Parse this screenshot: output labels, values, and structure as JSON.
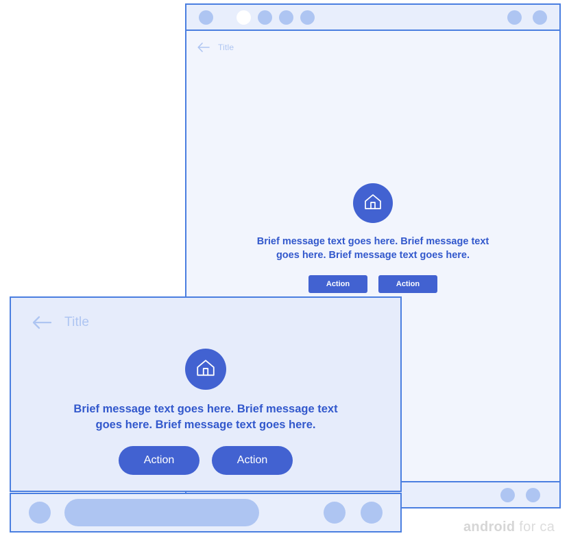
{
  "meta": {
    "watermark_bold": "android",
    "watermark_rest": " for ca"
  },
  "rear_window": {
    "status_bar": {
      "left_dots": [
        {
          "name": "status-dot-1",
          "filled": false
        },
        {
          "name": "status-dot-2",
          "filled": true
        },
        {
          "name": "status-dot-3",
          "filled": false
        },
        {
          "name": "status-dot-4",
          "filled": false
        },
        {
          "name": "status-dot-5",
          "filled": false
        }
      ],
      "right_dots": [
        {
          "name": "status-dot-right-1"
        },
        {
          "name": "status-dot-right-2"
        }
      ]
    },
    "app_bar": {
      "back_icon": "back-arrow-icon",
      "title": "Title"
    },
    "content": {
      "icon": "home-icon",
      "message": "Brief message text goes here. Brief message text goes here. Brief message text goes here.",
      "buttons": [
        {
          "label": "Action"
        },
        {
          "label": "Action"
        }
      ]
    },
    "bottom_bar": {
      "dots": [
        {
          "name": "bottom-dot-1"
        },
        {
          "name": "bottom-dot-2"
        }
      ]
    }
  },
  "front_window": {
    "app_bar": {
      "back_icon": "back-arrow-icon",
      "title": "Title"
    },
    "content": {
      "icon": "home-icon",
      "message": "Brief message text goes here. Brief message text goes here. Brief message text goes here.",
      "buttons": [
        {
          "label": "Action"
        },
        {
          "label": "Action"
        }
      ]
    },
    "nav_bar": {
      "home_dot": "nav-home-button",
      "search_pill": "nav-search-field",
      "right_dots": [
        {
          "name": "nav-dot-1"
        },
        {
          "name": "nav-dot-2"
        }
      ]
    }
  },
  "colors": {
    "accent": "#4262d1",
    "text_blue": "#3258cc",
    "muted_blue": "#aec5f2",
    "border_blue": "#4a7ee0",
    "rear_surface": "#f2f5fd",
    "front_surface": "#e6ecfb",
    "bar_surface": "#e8eefc"
  }
}
